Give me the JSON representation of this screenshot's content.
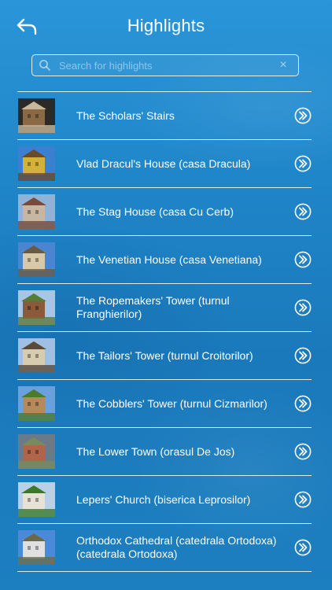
{
  "header": {
    "title": "Highlights",
    "back_icon": "back-arrow-icon"
  },
  "search": {
    "placeholder": "Search for highlights",
    "value": "",
    "search_icon": "search-icon",
    "clear_icon": "clear-icon",
    "clear_glyph": "×"
  },
  "items": [
    {
      "label": "The Scholars' Stairs",
      "thumb_colors": [
        "#2b2a26",
        "#8a6a45",
        "#c9b79a"
      ]
    },
    {
      "label": "Vlad Dracul's House (casa Dracula)",
      "thumb_colors": [
        "#3a7fd0",
        "#d4b23a",
        "#6b4a2a"
      ]
    },
    {
      "label": "The Stag House (casa Cu Cerb)",
      "thumb_colors": [
        "#8fb3d6",
        "#c7b6a2",
        "#7a4a3a"
      ]
    },
    {
      "label": "The Venetian House (casa Venetiana)",
      "thumb_colors": [
        "#4a86d0",
        "#d8c9a8",
        "#6a5a44"
      ]
    },
    {
      "label": "The Ropemakers' Tower (turnul Franghierilor)",
      "thumb_colors": [
        "#a7c5e4",
        "#8a5a3a",
        "#5a7a3a"
      ]
    },
    {
      "label": "The Tailors' Tower (turnul Croitorilor)",
      "thumb_colors": [
        "#9fc0e2",
        "#d7cbb0",
        "#5a4a3a"
      ]
    },
    {
      "label": "The Cobblers' Tower (turnul Cizmarilor)",
      "thumb_colors": [
        "#6aa1dd",
        "#b48a5a",
        "#4a7a2a"
      ]
    },
    {
      "label": "The Lower Town (orasul De Jos)",
      "thumb_colors": [
        "#6a7a8a",
        "#b0644a",
        "#7a8a5a"
      ]
    },
    {
      "label": "Lepers' Church (biserica Leprosilor)",
      "thumb_colors": [
        "#b8d0e8",
        "#e8e2d6",
        "#3a7a2a"
      ]
    },
    {
      "label": "Orthodox Cathedral (catedrala Ortodoxa) (catedrala Ortodoxa)",
      "thumb_colors": [
        "#4a8ad8",
        "#e0e0e0",
        "#6a6a4a"
      ]
    }
  ]
}
